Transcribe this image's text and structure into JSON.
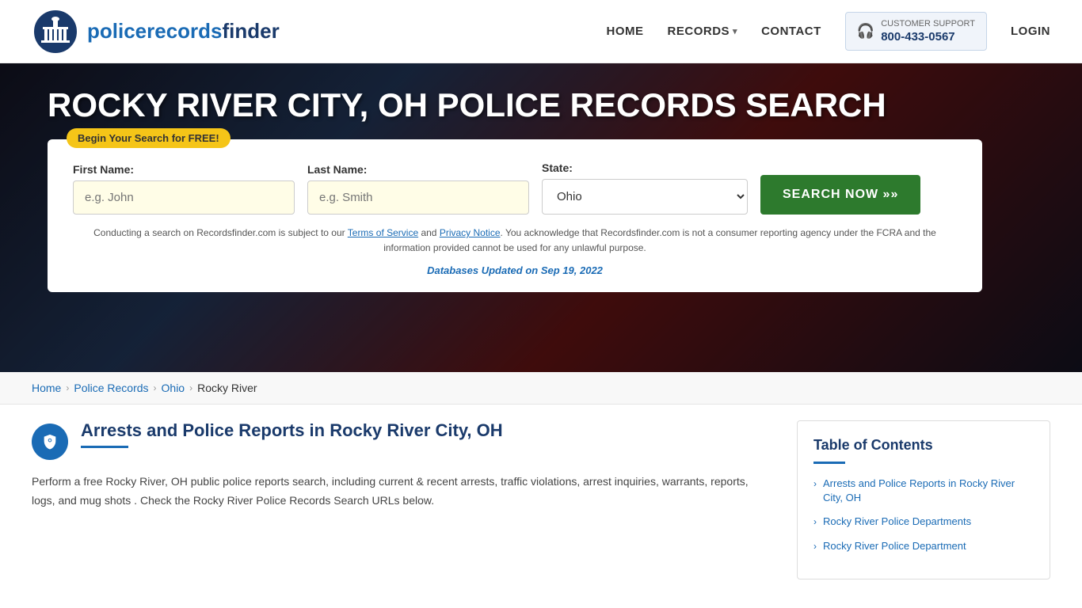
{
  "header": {
    "logo_text_regular": "policerecords",
    "logo_text_bold": "finder",
    "nav": {
      "home": "HOME",
      "records": "RECORDS",
      "contact": "CONTACT",
      "login": "LOGIN"
    },
    "support": {
      "label": "CUSTOMER SUPPORT",
      "phone": "800-433-0567"
    }
  },
  "hero": {
    "title": "ROCKY RIVER CITY, OH POLICE RECORDS SEARCH",
    "free_badge": "Begin Your Search for FREE!",
    "search": {
      "first_name_label": "First Name:",
      "first_name_placeholder": "e.g. John",
      "last_name_label": "Last Name:",
      "last_name_placeholder": "e.g. Smith",
      "state_label": "State:",
      "state_value": "Ohio",
      "search_button": "SEARCH NOW »»"
    },
    "disclaimer": "Conducting a search on Recordsfinder.com is subject to our Terms of Service and Privacy Notice. You acknowledge that Recordsfinder.com is not a consumer reporting agency under the FCRA and the information provided cannot be used for any unlawful purpose.",
    "db_updated_label": "Databases Updated on",
    "db_updated_date": "Sep 19, 2022"
  },
  "breadcrumb": {
    "home": "Home",
    "police_records": "Police Records",
    "ohio": "Ohio",
    "current": "Rocky River"
  },
  "article": {
    "title": "Arrests and Police Reports in Rocky River City, OH",
    "body": "Perform a free Rocky River, OH public police reports search, including current & recent arrests, traffic violations, arrest inquiries, warrants, reports, logs, and mug shots . Check the Rocky River Police Records Search URLs below."
  },
  "toc": {
    "title": "Table of Contents",
    "items": [
      "Arrests and Police Reports in Rocky River City, OH",
      "Rocky River Police Departments",
      "Rocky River Police Department"
    ]
  }
}
